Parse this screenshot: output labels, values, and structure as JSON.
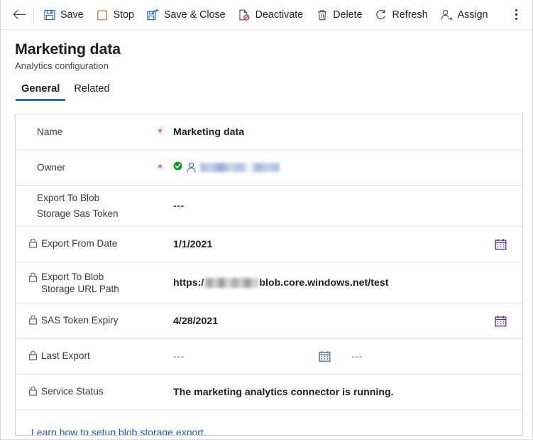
{
  "commandbar": {
    "back_label": "Back",
    "items": [
      {
        "label": "Save",
        "icon": "save-icon"
      },
      {
        "label": "Stop",
        "icon": "stop-icon"
      },
      {
        "label": "Save & Close",
        "icon": "save-and-close-icon"
      },
      {
        "label": "Deactivate",
        "icon": "deactivate-icon"
      },
      {
        "label": "Delete",
        "icon": "delete-icon"
      },
      {
        "label": "Refresh",
        "icon": "refresh-icon"
      },
      {
        "label": "Assign",
        "icon": "assign-icon"
      }
    ],
    "overflow_label": "More commands"
  },
  "header": {
    "title": "Marketing data",
    "subtitle": "Analytics configuration"
  },
  "tabs": [
    {
      "label": "General",
      "active": true
    },
    {
      "label": "Related",
      "active": false
    }
  ],
  "form": {
    "rows": [
      {
        "name": "name",
        "label": "Name",
        "required": true,
        "locked": false,
        "value": "Marketing data"
      },
      {
        "name": "owner",
        "label": "Owner",
        "required": true,
        "locked": false,
        "value": ""
      },
      {
        "name": "export-to-blob-storage-sas-token",
        "label_line1": "Export To Blob",
        "label_line2": "Storage Sas Token",
        "required": false,
        "locked": false,
        "value": "---"
      },
      {
        "name": "export-from-date",
        "label": "Export From Date",
        "required": false,
        "locked": true,
        "value": "1/1/2021"
      },
      {
        "name": "export-to-blob-storage-url-path",
        "label_line1": "Export To Blob",
        "label_line2": "Storage URL Path",
        "required": false,
        "locked": true,
        "value_prefix": "https:/",
        "value_suffix": "blob.core.windows.net/test"
      },
      {
        "name": "sas-token-expiry",
        "label": "SAS Token Expiry",
        "required": false,
        "locked": true,
        "value": "4/28/2021"
      },
      {
        "name": "last-export",
        "label": "Last Export",
        "required": false,
        "locked": true,
        "date_value": "---",
        "time_value": "---"
      },
      {
        "name": "service-status",
        "label": "Service Status",
        "required": false,
        "locked": true,
        "value": "The marketing analytics connector is running."
      }
    ],
    "link": {
      "label": "Learn how to setup blob storage export."
    }
  },
  "colors": {
    "accent": "#0078d4",
    "required": "#e81123",
    "link": "#1a5fb4",
    "valid_badge": "#0f9d23",
    "calendar_icon": "#5c2d91",
    "text": "#201f1e"
  }
}
